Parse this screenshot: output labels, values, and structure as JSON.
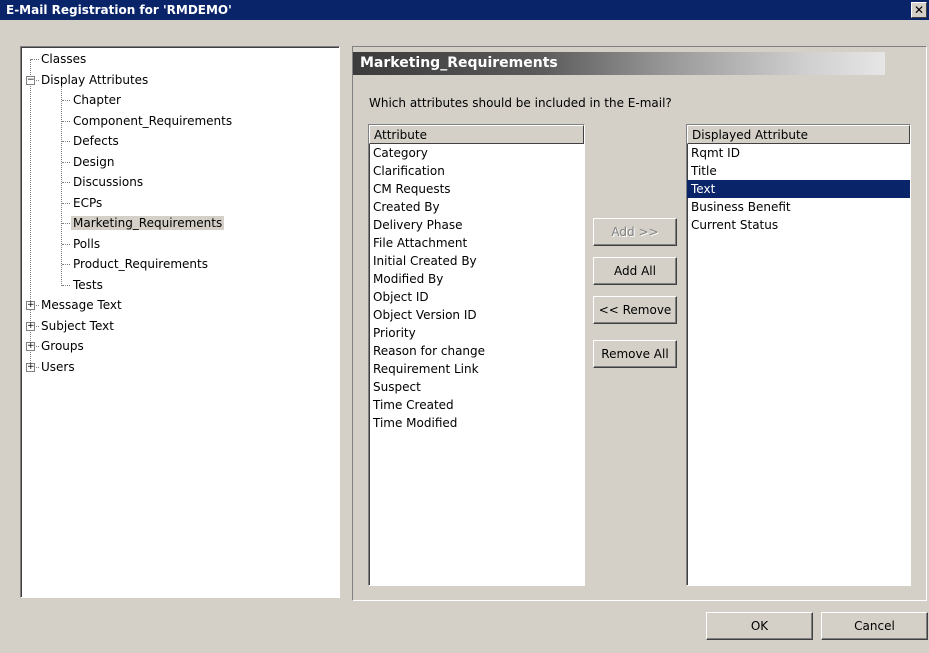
{
  "window": {
    "title": "E-Mail Registration for 'RMDEMO'",
    "close_glyph": "✕"
  },
  "tree": {
    "nodes": [
      {
        "label": "Classes",
        "expander": ""
      },
      {
        "label": "Display Attributes",
        "expander": "−"
      },
      {
        "label": "Chapter"
      },
      {
        "label": "Component_Requirements"
      },
      {
        "label": "Defects"
      },
      {
        "label": "Design"
      },
      {
        "label": "Discussions"
      },
      {
        "label": "ECPs"
      },
      {
        "label": "Marketing_Requirements",
        "selected": true
      },
      {
        "label": "Polls"
      },
      {
        "label": "Product_Requirements"
      },
      {
        "label": "Tests"
      },
      {
        "label": "Message Text",
        "expander": "+"
      },
      {
        "label": "Subject Text",
        "expander": "+"
      },
      {
        "label": "Groups",
        "expander": "+"
      },
      {
        "label": "Users",
        "expander": "+"
      }
    ]
  },
  "panel": {
    "title": "Marketing_Requirements",
    "question": "Which attributes should be included in the E-mail?"
  },
  "available": {
    "header": "Attribute",
    "items": [
      "Category",
      "Clarification",
      "CM Requests",
      "Created By",
      "Delivery Phase",
      "File Attachment",
      "Initial Created By",
      "Modified By",
      "Object ID",
      "Object Version ID",
      "Priority",
      "Reason for change",
      "Requirement Link",
      "Suspect",
      "Time Created",
      "Time Modified"
    ]
  },
  "displayed": {
    "header": "Displayed Attribute",
    "items": [
      "Rqmt ID",
      "Title",
      "Text",
      "Business Benefit",
      "Current Status"
    ],
    "selected_index": 2
  },
  "buttons": {
    "add": "Add >>",
    "add_all": "Add All",
    "remove": "<< Remove",
    "remove_all": "Remove All",
    "ok": "OK",
    "cancel": "Cancel"
  },
  "colors": {
    "title_bar": "#0a246a",
    "selection": "#0a246a",
    "face": "#d4d0c8"
  }
}
